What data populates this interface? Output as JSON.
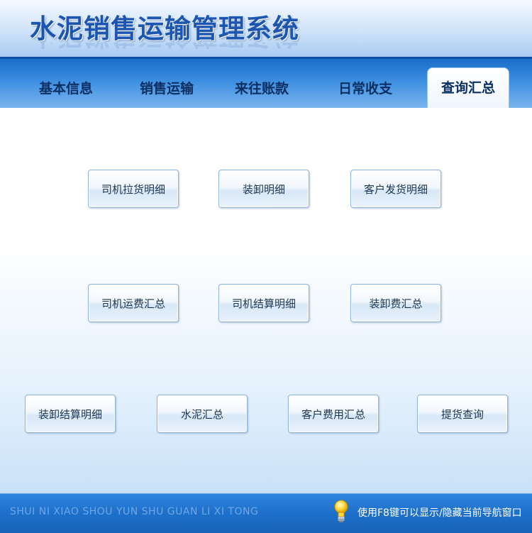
{
  "app": {
    "title": "水泥销售运输管理系统"
  },
  "tabs": [
    {
      "label": "基本信息",
      "active": false
    },
    {
      "label": "销售运输",
      "active": false
    },
    {
      "label": "来往账款",
      "active": false
    },
    {
      "label": "日常收支",
      "active": false
    },
    {
      "label": "查询汇总",
      "active": true
    }
  ],
  "buttons": {
    "row1": [
      "司机拉货明细",
      "装卸明细",
      "客户发货明细"
    ],
    "row2": [
      "司机运费汇总",
      "司机结算明细",
      "装卸费汇总"
    ],
    "row3": [
      "装卸结算明细",
      "水泥汇总",
      "客户费用汇总",
      "提货查询"
    ]
  },
  "footer": {
    "pinyin": "SHUI NI XIAO SHOU YUN SHU GUAN LI XI TONG",
    "hint": "使用F8键可以显示/隐藏当前导航窗口",
    "hint_icon": "lightbulb-icon"
  },
  "colors": {
    "title": "#1d56b0",
    "tabbar": "#3d8ee0",
    "footer": "#1d6fc9",
    "button_text": "#1a3552"
  }
}
